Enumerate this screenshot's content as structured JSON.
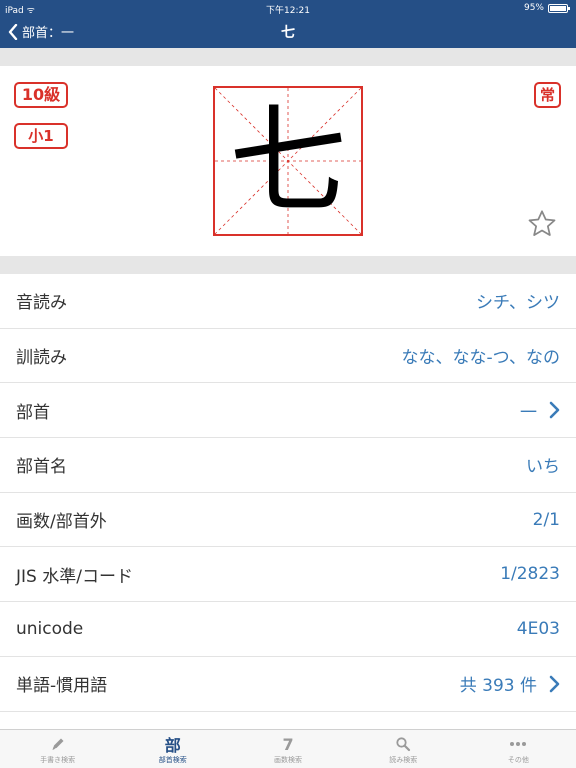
{
  "status_bar": {
    "device": "iPad",
    "time": "下午12:21",
    "battery": "95%"
  },
  "nav": {
    "back_label": "部首：一",
    "title": "七"
  },
  "kanji": {
    "character": "七",
    "badge_grade": "10級",
    "badge_school": "小1",
    "badge_joyo": "常"
  },
  "rows": [
    {
      "label": "音読み",
      "value": "シチ、シツ"
    },
    {
      "label": "訓読み",
      "value": "なな、なな-つ、なの"
    },
    {
      "label": "部首",
      "value": "一"
    },
    {
      "label": "部首名",
      "value": "いち"
    },
    {
      "label": "画数/部首外",
      "value": "2/1"
    },
    {
      "label": "JIS 水準/コード",
      "value": "1/2823"
    },
    {
      "label": "unicode",
      "value": "4E03"
    },
    {
      "label": "単語-慣用語",
      "value": "共 393 件"
    },
    {
      "label": "…",
      "value": ""
    }
  ],
  "tabs": [
    {
      "label": "手書き検索",
      "icon": "pencil-icon"
    },
    {
      "label": "部首検索",
      "icon": "部"
    },
    {
      "label": "画数検索",
      "icon": "7"
    },
    {
      "label": "読み検索",
      "icon": "search-icon"
    },
    {
      "label": "その他",
      "icon": "more-icon"
    }
  ],
  "colors": {
    "nav_bg": "#254f86",
    "accent": "#3a7bb8",
    "badge_red": "#d9312a"
  }
}
